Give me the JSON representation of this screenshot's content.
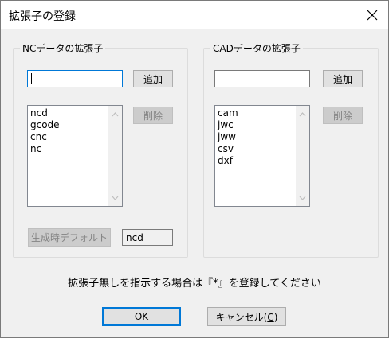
{
  "window": {
    "title": "拡張子の登録",
    "close_icon": "close-icon"
  },
  "nc": {
    "group_label": "NCデータの拡張子",
    "input_value": "",
    "add_label": "追加",
    "delete_label": "削除",
    "extensions": [
      "ncd",
      "gcode",
      "cnc",
      "nc"
    ],
    "default_button_label": "生成時デフォルト",
    "default_value": "ncd"
  },
  "cad": {
    "group_label": "CADデータの拡張子",
    "input_value": "",
    "add_label": "追加",
    "delete_label": "削除",
    "extensions": [
      "cam",
      "jwc",
      "jww",
      "csv",
      "dxf"
    ]
  },
  "note": "拡張子無しを指示する場合は『*』を登録してください",
  "buttons": {
    "ok_label": "OK",
    "ok_mnemonic": "O",
    "ok_rest": "K",
    "cancel_prefix": "キャンセル(",
    "cancel_mnemonic": "C",
    "cancel_suffix": ")"
  }
}
